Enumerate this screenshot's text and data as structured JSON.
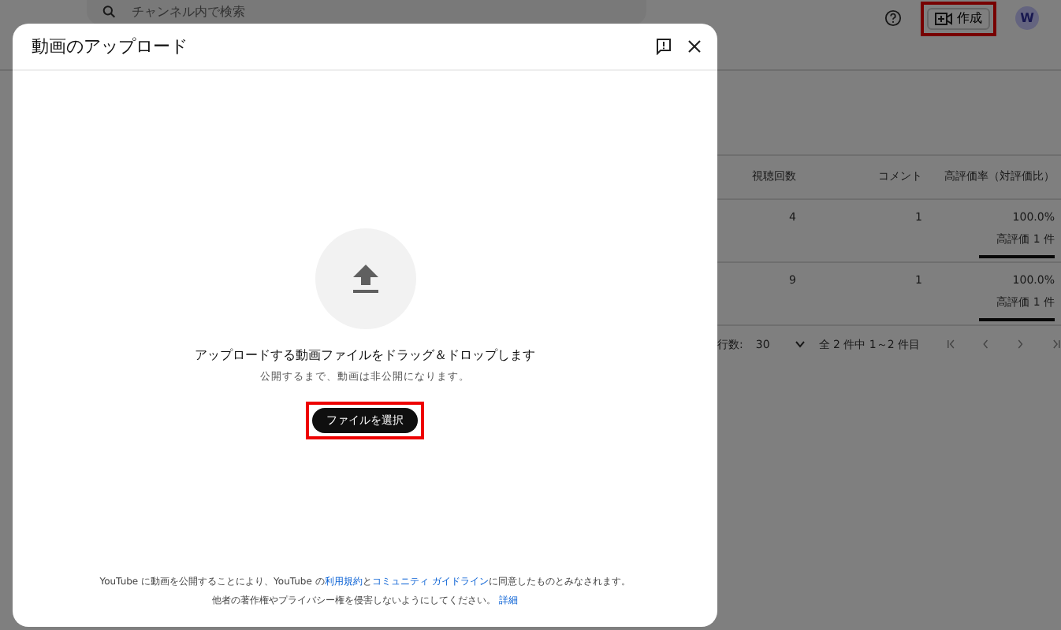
{
  "topbar": {
    "search": {
      "placeholder": "チャンネル内で検索"
    },
    "create_button": {
      "label": "作成",
      "highlighted": true
    },
    "avatar": {
      "initial": "W"
    }
  },
  "table": {
    "columns": [
      "視聴回数",
      "コメント",
      "高評価率（対評価比）"
    ],
    "rows": [
      {
        "views": "4",
        "comments": "1",
        "rate": "100.0%",
        "likes": "高評価 1 件",
        "level": 1
      },
      {
        "views": "9",
        "comments": "1",
        "rate": "100.0%",
        "likes": "高評価 1 件",
        "level": 1
      }
    ],
    "pagination": {
      "rows_label": "行数:",
      "rows_value": "30",
      "range": "全 2 件中 1～2 件目"
    }
  },
  "dialog": {
    "title": "動画のアップロード",
    "prompt": "アップロードする動画ファイルをドラッグ＆ドロップします",
    "note": "公開するまで、動画は非公開になります。",
    "select_button": {
      "label": "ファイルを選択",
      "highlighted": true
    },
    "footer": [
      {
        "kind": "terms",
        "before": "YouTube に動画を公開することにより、YouTube の",
        "link1": "利用規約",
        "mid": "と",
        "link2": "コミュニティ ガイドライン",
        "after": "に同意したものとみなされます。"
      },
      {
        "kind": "privacy",
        "before": "他者の著作権やプライバシー権を侵害しないようにしてください。",
        "link1": "詳細"
      }
    ]
  }
}
